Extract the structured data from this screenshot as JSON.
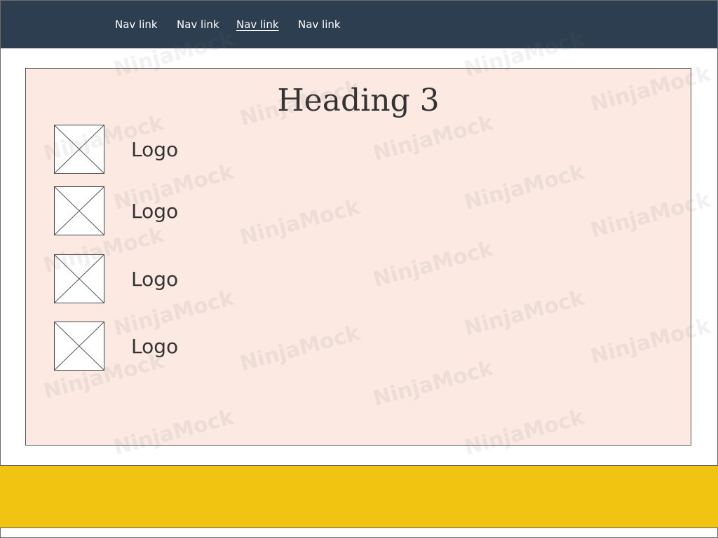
{
  "nav": {
    "links": [
      {
        "label": "Nav link"
      },
      {
        "label": "Nav link"
      },
      {
        "label": "Nav link"
      },
      {
        "label": "Nav link"
      }
    ]
  },
  "main": {
    "heading": "Heading 3",
    "items": [
      {
        "label": "Logo"
      },
      {
        "label": "Logo"
      },
      {
        "label": "Logo"
      },
      {
        "label": "Logo"
      }
    ]
  },
  "watermark": "NinjaMock",
  "colors": {
    "navbar": "#2c3e50",
    "panel": "#fbe9e2",
    "footer": "#f1c411"
  }
}
